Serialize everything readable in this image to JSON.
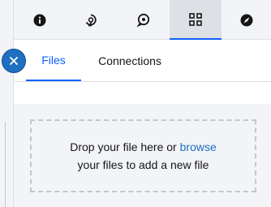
{
  "toolbar": {
    "icons": [
      {
        "name": "info-icon",
        "active": false
      },
      {
        "name": "pin-icon",
        "active": false
      },
      {
        "name": "comment-icon",
        "active": false
      },
      {
        "name": "data-icon",
        "active": true
      },
      {
        "name": "compass-icon",
        "active": false
      }
    ]
  },
  "panel": {
    "tabs": [
      {
        "label": "Files",
        "active": true
      },
      {
        "label": "Connections",
        "active": false
      }
    ],
    "dropzone": {
      "text_before": "Drop your file here or ",
      "link": "browse",
      "text_after": "your files to add a new file"
    }
  },
  "colors": {
    "accent": "#0f62fe",
    "link": "#1f70c1",
    "close_button": "#1f70c1",
    "toolbar_bg": "#f2f4f8",
    "active_tab_bg": "#dde1e6"
  }
}
